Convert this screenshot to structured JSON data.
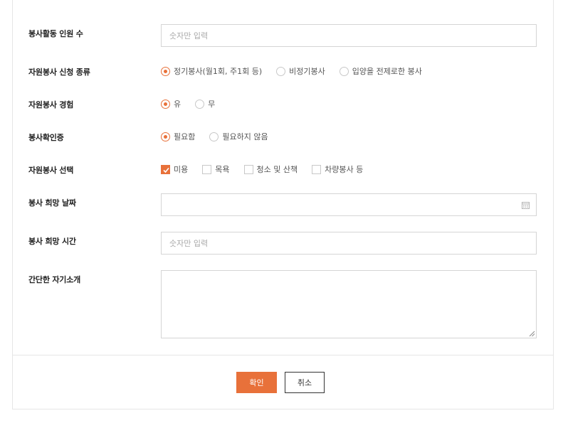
{
  "form": {
    "volunteer_count": {
      "label": "봉사활동 인원 수",
      "placeholder": "숫자만 입력"
    },
    "application_type": {
      "label": "자원봉사 신청 종류",
      "options": [
        "정기봉사(월1회, 주1회 등)",
        "비정기봉사",
        "입양을 전제로한 봉사"
      ],
      "selected": "정기봉사(월1회, 주1회 등)"
    },
    "experience": {
      "label": "자원봉사 경험",
      "options": [
        "유",
        "무"
      ],
      "selected": "유"
    },
    "certificate": {
      "label": "봉사확인증",
      "options": [
        "필요함",
        "필요하지 않음"
      ],
      "selected": "필요함"
    },
    "selection": {
      "label": "자원봉사 선택",
      "options": [
        "미용",
        "목욕",
        "청소 및 산책",
        "차량봉사 등"
      ],
      "checked": [
        "미용"
      ]
    },
    "desired_date": {
      "label": "봉사 희망 날짜",
      "value": ""
    },
    "desired_time": {
      "label": "봉사 희망 시간",
      "placeholder": "숫자만 입력"
    },
    "intro": {
      "label": "간단한 자기소개",
      "value": ""
    }
  },
  "buttons": {
    "confirm": "확인",
    "cancel": "취소"
  },
  "colors": {
    "accent": "#e8713a",
    "border": "#d5d5d5",
    "label": "#222222"
  },
  "icons": {
    "date_picker": "calendar-icon",
    "textarea_resize": "resize-handle-icon"
  }
}
